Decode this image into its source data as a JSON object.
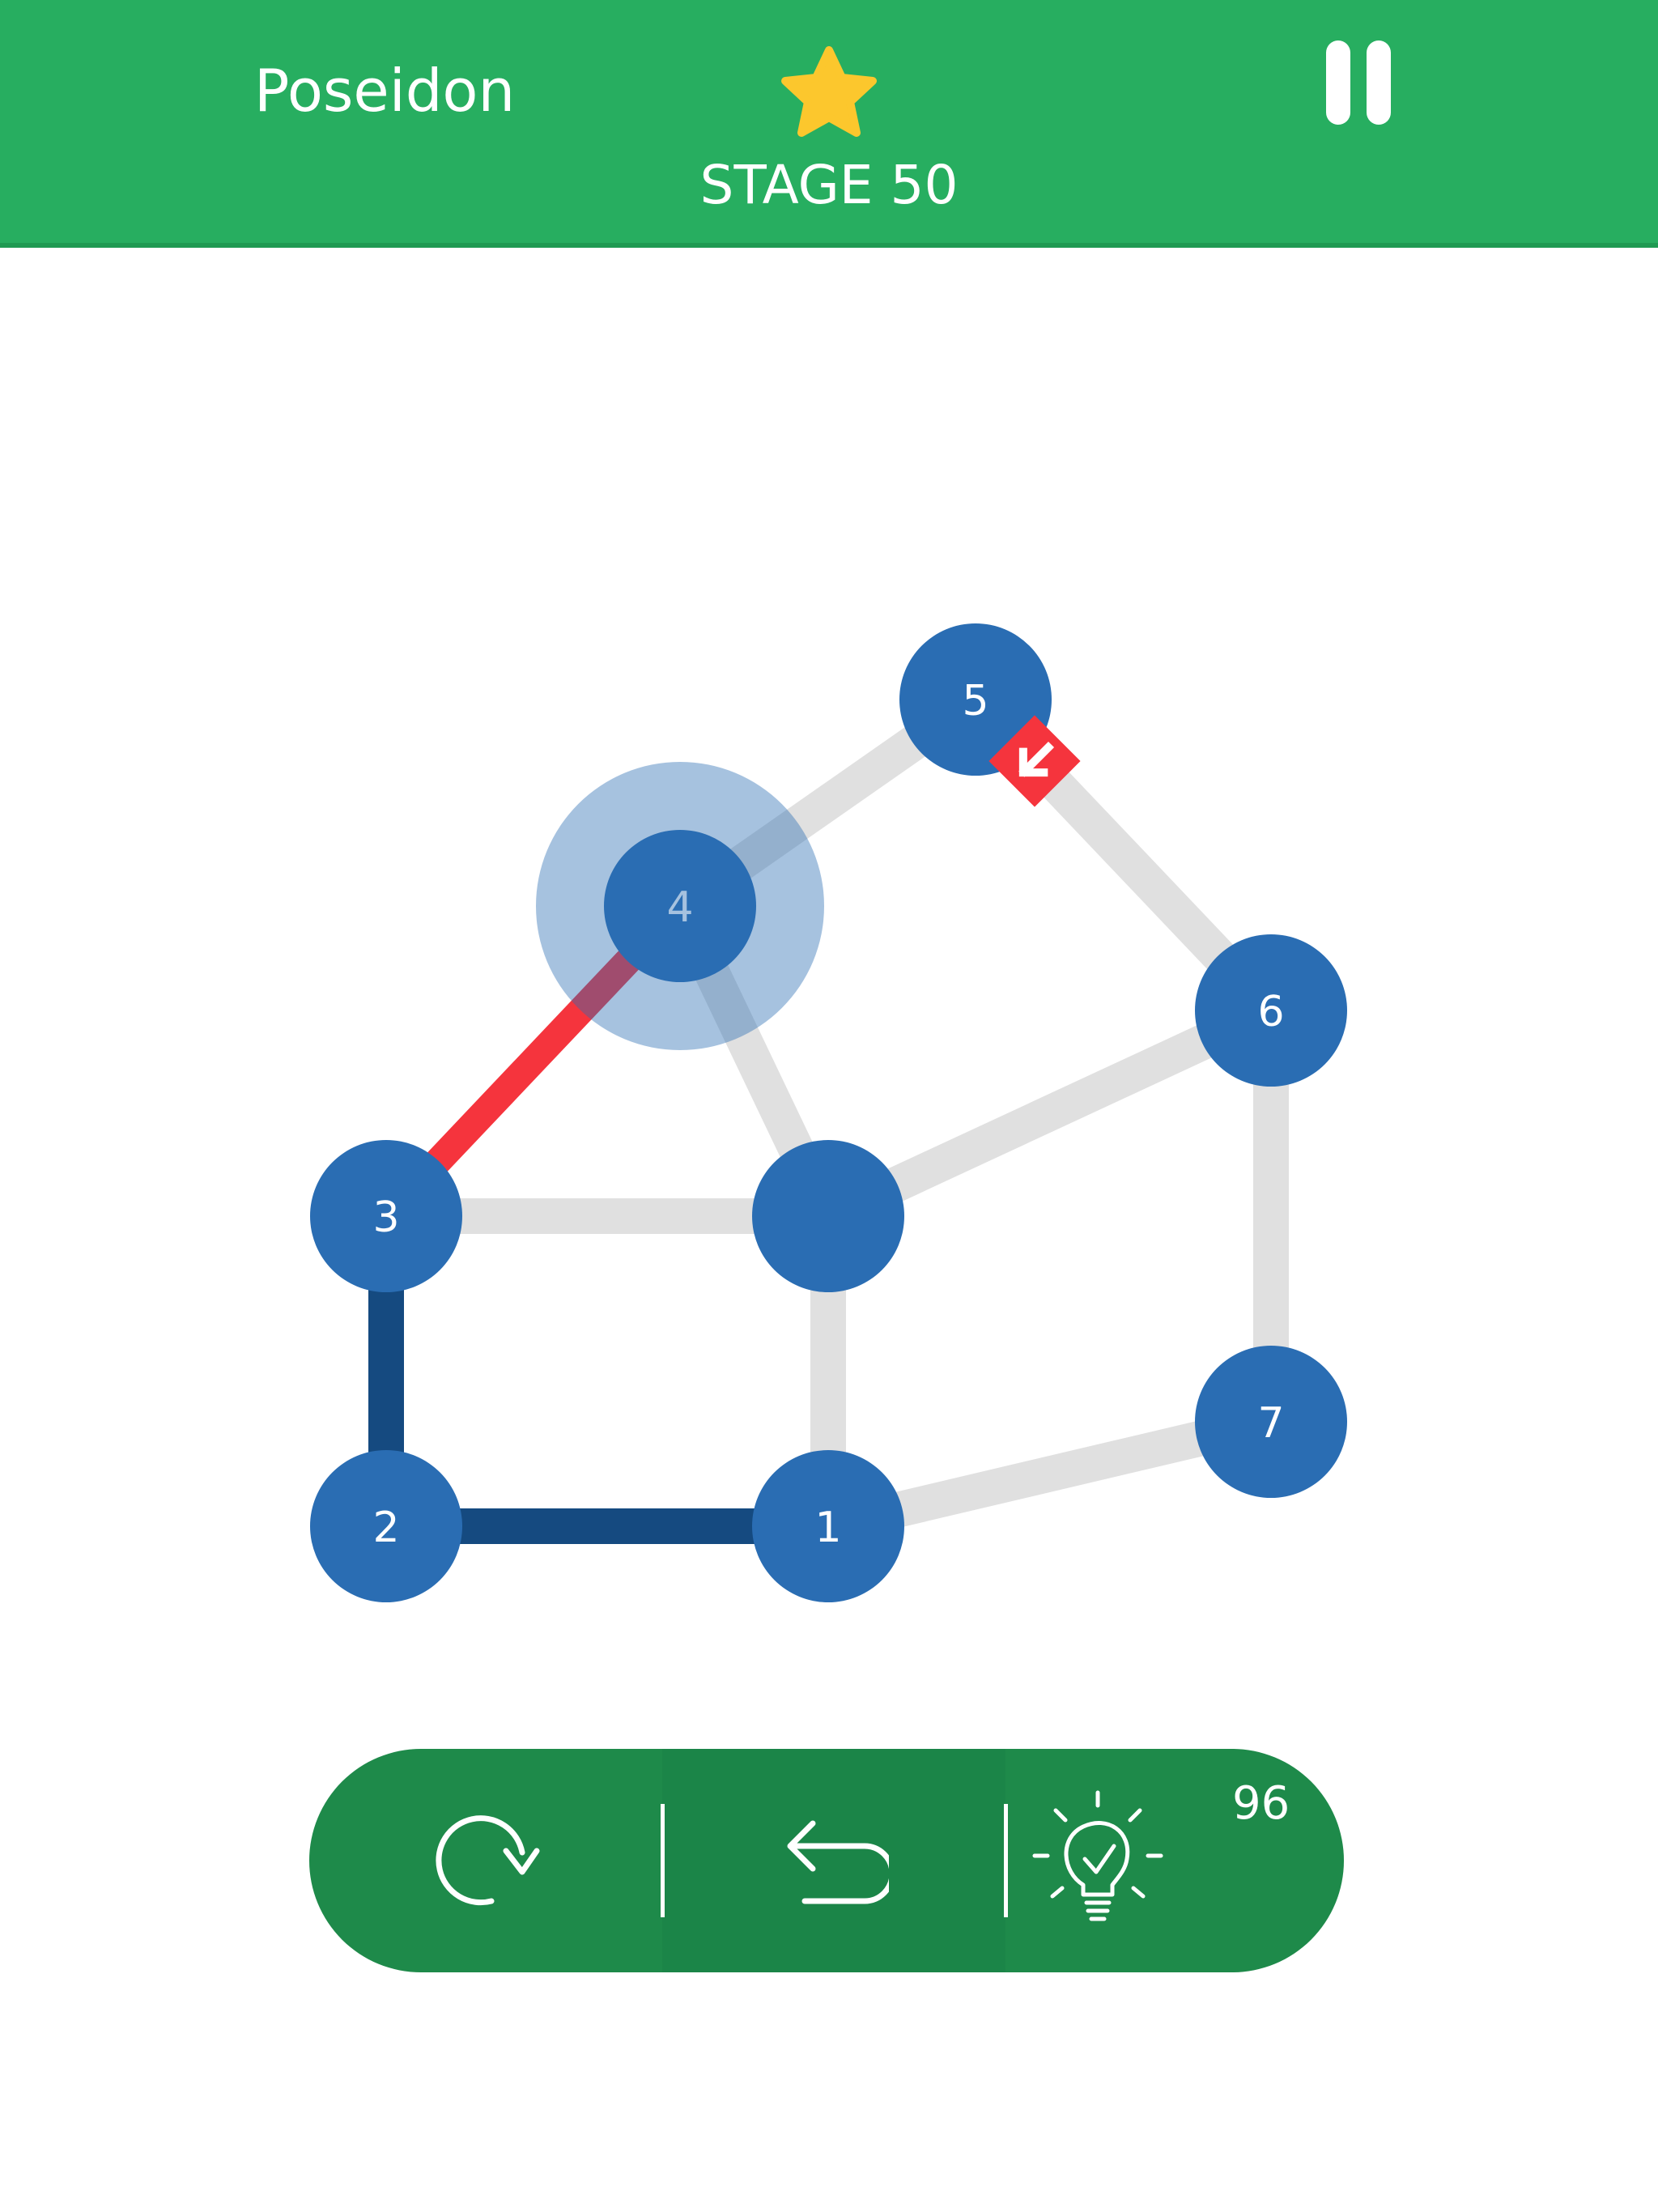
{
  "header": {
    "level_name": "Poseidon",
    "stage_label": "STAGE 50",
    "icons": {
      "star": "star-icon",
      "pause": "pause-icon"
    }
  },
  "puzzle": {
    "nodes": [
      {
        "id": "n1",
        "label": "1"
      },
      {
        "id": "n2",
        "label": "2"
      },
      {
        "id": "n3",
        "label": "3"
      },
      {
        "id": "n4",
        "label": "4"
      },
      {
        "id": "n5",
        "label": "5"
      },
      {
        "id": "n6",
        "label": "6"
      },
      {
        "id": "n7",
        "label": "7"
      },
      {
        "id": "nc",
        "label": ""
      }
    ],
    "current_node": "4",
    "direction_marker": "arrow-down-right-icon"
  },
  "toolbar": {
    "restart_icon": "restart-icon",
    "undo_icon": "undo-icon",
    "hint_icon": "lightbulb-hint-icon",
    "hint_count": "96"
  },
  "colors": {
    "header": "#27ae60",
    "node": "#2a6db3",
    "edge_unvisited": "#e0e0e0",
    "edge_visited": "#154a80",
    "edge_active": "#f5343d",
    "toolbar": "#1e8a4a",
    "star": "#fcc72d"
  }
}
